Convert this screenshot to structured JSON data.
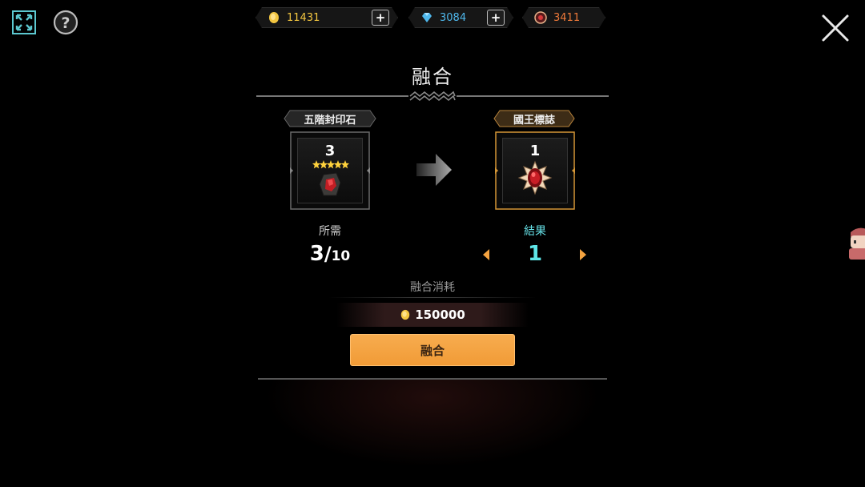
{
  "currency": {
    "gold": "11431",
    "gem": "3084",
    "crystal": "3411",
    "gold_color": "#f3c640",
    "gem_color": "#4fb8ec",
    "crystal_color": "#f07a3a"
  },
  "panel": {
    "title": "融合",
    "source": {
      "name": "五階封印石",
      "count": "3",
      "icon": "sealed-stone-icon"
    },
    "result": {
      "name": "國王標誌",
      "count": "1",
      "icon": "king-emblem-icon"
    },
    "required_label": "所需",
    "required_have": "3",
    "required_slash": "/",
    "required_total": "10",
    "result_label": "結果",
    "result_value": "1",
    "cost_title": "融合消耗",
    "cost_value": "150000",
    "fuse_button_label": "融合"
  },
  "colors": {
    "accent_orange": "#f4a340",
    "result_cyan": "#5ee6e8"
  }
}
